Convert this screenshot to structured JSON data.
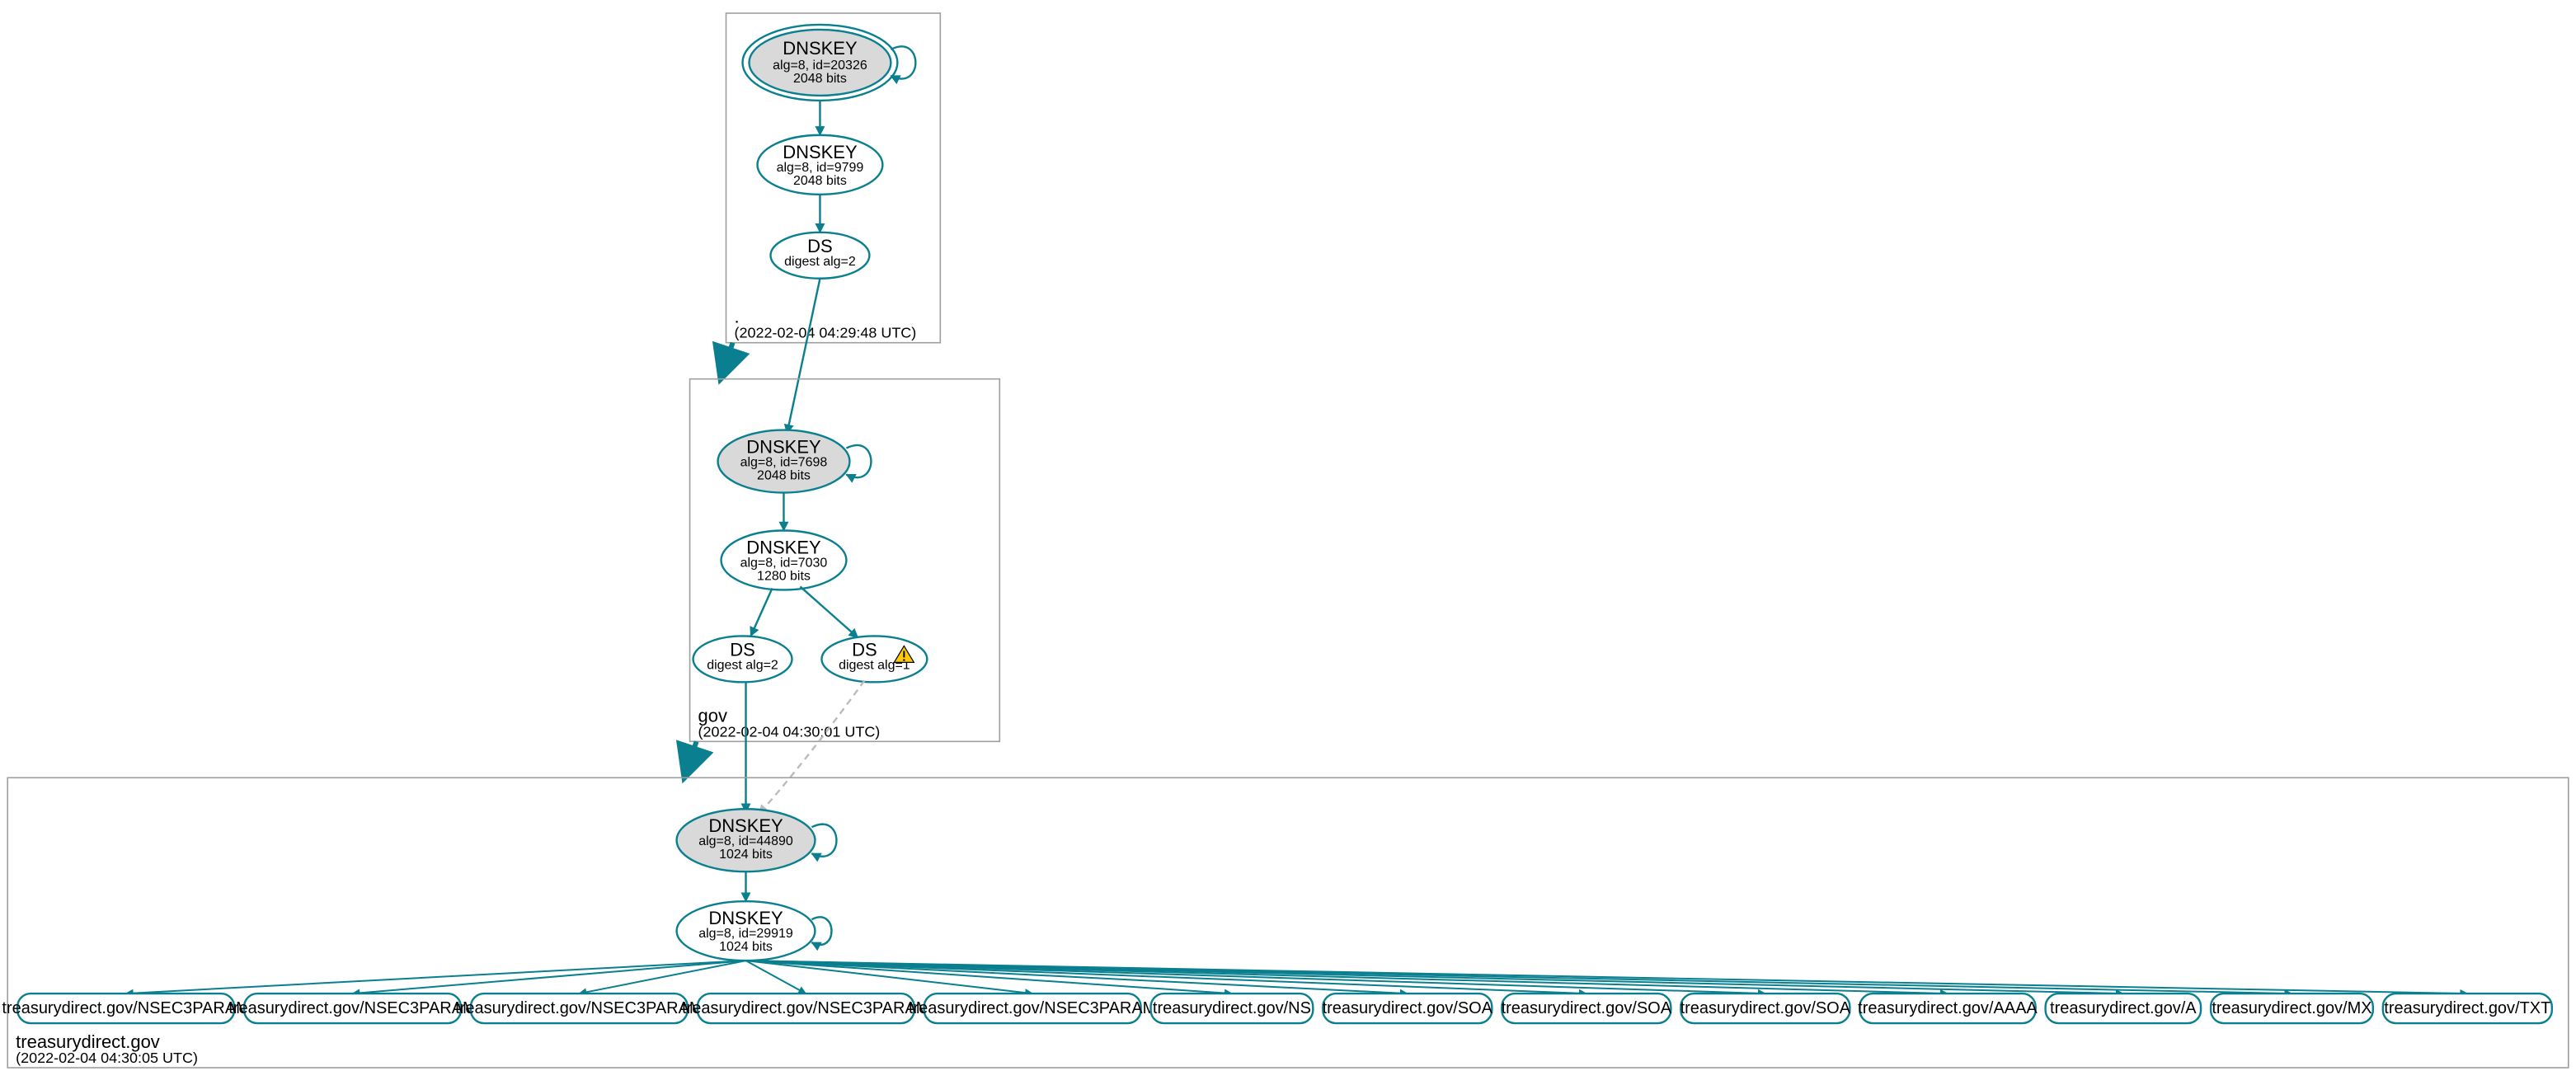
{
  "colors": {
    "stroke": "#0a7f8f",
    "strokeLight": "#bbbbbb",
    "fillKSK": "#d9d9d9",
    "fillPlain": "#ffffff",
    "zoneBorder": "#9e9e9e",
    "warnFill": "#ffcc00",
    "warnStroke": "#000000"
  },
  "zones": {
    "root": {
      "label": ".",
      "timestamp": "(2022-02-04 04:29:48 UTC)",
      "nodes": {
        "ksk": {
          "title": "DNSKEY",
          "line2": "alg=8, id=20326",
          "line3": "2048 bits"
        },
        "zsk": {
          "title": "DNSKEY",
          "line2": "alg=8, id=9799",
          "line3": "2048 bits"
        },
        "ds": {
          "title": "DS",
          "line2": "digest alg=2"
        }
      }
    },
    "gov": {
      "label": "gov",
      "timestamp": "(2022-02-04 04:30:01 UTC)",
      "nodes": {
        "ksk": {
          "title": "DNSKEY",
          "line2": "alg=8, id=7698",
          "line3": "2048 bits"
        },
        "zsk": {
          "title": "DNSKEY",
          "line2": "alg=8, id=7030",
          "line3": "1280 bits"
        },
        "ds1": {
          "title": "DS",
          "line2": "digest alg=2"
        },
        "ds2": {
          "title": "DS",
          "line2": "digest alg=1",
          "warn": true
        }
      }
    },
    "td": {
      "label": "treasurydirect.gov",
      "timestamp": "(2022-02-04 04:30:05 UTC)",
      "nodes": {
        "ksk": {
          "title": "DNSKEY",
          "line2": "alg=8, id=44890",
          "line3": "1024 bits"
        },
        "zsk": {
          "title": "DNSKEY",
          "line2": "alg=8, id=29919",
          "line3": "1024 bits"
        }
      },
      "records": [
        "treasurydirect.gov/NSEC3PARAM",
        "treasurydirect.gov/NSEC3PARAM",
        "treasurydirect.gov/NSEC3PARAM",
        "treasurydirect.gov/NSEC3PARAM",
        "treasurydirect.gov/NSEC3PARAM",
        "treasurydirect.gov/NS",
        "treasurydirect.gov/SOA",
        "treasurydirect.gov/SOA",
        "treasurydirect.gov/SOA",
        "treasurydirect.gov/AAAA",
        "treasurydirect.gov/A",
        "treasurydirect.gov/MX",
        "treasurydirect.gov/TXT"
      ]
    }
  }
}
